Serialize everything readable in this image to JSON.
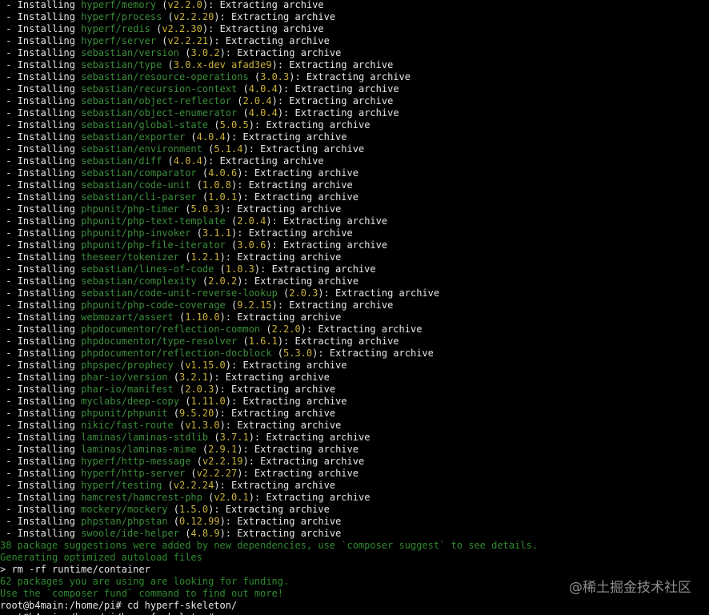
{
  "install_prefix": " - Installing ",
  "extract_suffix": ": Extracting archive",
  "installs": [
    {
      "pkg": "hyperf/memory",
      "ver": "v2.2.0"
    },
    {
      "pkg": "hyperf/process",
      "ver": "v2.2.20"
    },
    {
      "pkg": "hyperf/redis",
      "ver": "v2.2.30"
    },
    {
      "pkg": "hyperf/server",
      "ver": "v2.2.21"
    },
    {
      "pkg": "sebastian/version",
      "ver": "3.0.2"
    },
    {
      "pkg": "sebastian/type",
      "ver": "3.0.x-dev afad3e9"
    },
    {
      "pkg": "sebastian/resource-operations",
      "ver": "3.0.3"
    },
    {
      "pkg": "sebastian/recursion-context",
      "ver": "4.0.4"
    },
    {
      "pkg": "sebastian/object-reflector",
      "ver": "2.0.4"
    },
    {
      "pkg": "sebastian/object-enumerator",
      "ver": "4.0.4"
    },
    {
      "pkg": "sebastian/global-state",
      "ver": "5.0.5"
    },
    {
      "pkg": "sebastian/exporter",
      "ver": "4.0.4"
    },
    {
      "pkg": "sebastian/environment",
      "ver": "5.1.4"
    },
    {
      "pkg": "sebastian/diff",
      "ver": "4.0.4"
    },
    {
      "pkg": "sebastian/comparator",
      "ver": "4.0.6"
    },
    {
      "pkg": "sebastian/code-unit",
      "ver": "1.0.8"
    },
    {
      "pkg": "sebastian/cli-parser",
      "ver": "1.0.1"
    },
    {
      "pkg": "phpunit/php-timer",
      "ver": "5.0.3"
    },
    {
      "pkg": "phpunit/php-text-template",
      "ver": "2.0.4"
    },
    {
      "pkg": "phpunit/php-invoker",
      "ver": "3.1.1"
    },
    {
      "pkg": "phpunit/php-file-iterator",
      "ver": "3.0.6"
    },
    {
      "pkg": "theseer/tokenizer",
      "ver": "1.2.1"
    },
    {
      "pkg": "sebastian/lines-of-code",
      "ver": "1.0.3"
    },
    {
      "pkg": "sebastian/complexity",
      "ver": "2.0.2"
    },
    {
      "pkg": "sebastian/code-unit-reverse-lookup",
      "ver": "2.0.3"
    },
    {
      "pkg": "phpunit/php-code-coverage",
      "ver": "9.2.15"
    },
    {
      "pkg": "webmozart/assert",
      "ver": "1.10.0"
    },
    {
      "pkg": "phpdocumentor/reflection-common",
      "ver": "2.2.0"
    },
    {
      "pkg": "phpdocumentor/type-resolver",
      "ver": "1.6.1"
    },
    {
      "pkg": "phpdocumentor/reflection-docblock",
      "ver": "5.3.0"
    },
    {
      "pkg": "phpspec/prophecy",
      "ver": "v1.15.0"
    },
    {
      "pkg": "phar-io/version",
      "ver": "3.2.1"
    },
    {
      "pkg": "phar-io/manifest",
      "ver": "2.0.3"
    },
    {
      "pkg": "myclabs/deep-copy",
      "ver": "1.11.0"
    },
    {
      "pkg": "phpunit/phpunit",
      "ver": "9.5.20"
    },
    {
      "pkg": "nikic/fast-route",
      "ver": "v1.3.0"
    },
    {
      "pkg": "laminas/laminas-stdlib",
      "ver": "3.7.1"
    },
    {
      "pkg": "laminas/laminas-mime",
      "ver": "2.9.1"
    },
    {
      "pkg": "hyperf/http-message",
      "ver": "v2.2.19"
    },
    {
      "pkg": "hyperf/http-server",
      "ver": "v2.2.27"
    },
    {
      "pkg": "hyperf/testing",
      "ver": "v2.2.24"
    },
    {
      "pkg": "hamcrest/hamcrest-php",
      "ver": "v2.0.1"
    },
    {
      "pkg": "mockery/mockery",
      "ver": "1.5.0"
    },
    {
      "pkg": "phpstan/phpstan",
      "ver": "0.12.99"
    },
    {
      "pkg": "swoole/ide-helper",
      "ver": "4.8.9"
    }
  ],
  "tail": [
    {
      "text": "38 package suggestions were added by new dependencies, use `composer suggest` to see details.",
      "style": "green"
    },
    {
      "text": "Generating optimized autoload files",
      "style": "green"
    },
    {
      "text": "> rm -rf runtime/container",
      "style": "dim"
    },
    {
      "text": "62 packages you are using are looking for funding.",
      "style": "green"
    },
    {
      "text": "Use the `composer fund` command to find out more!",
      "style": "green"
    },
    {
      "text": "root@b4main:/home/pi# cd hyperf-skeleton/",
      "style": "dim"
    },
    {
      "text": "root@b4main:/home/pi/hyperf-skeleton#",
      "style": "dim"
    }
  ],
  "watermark": "@稀土掘金技术社区"
}
